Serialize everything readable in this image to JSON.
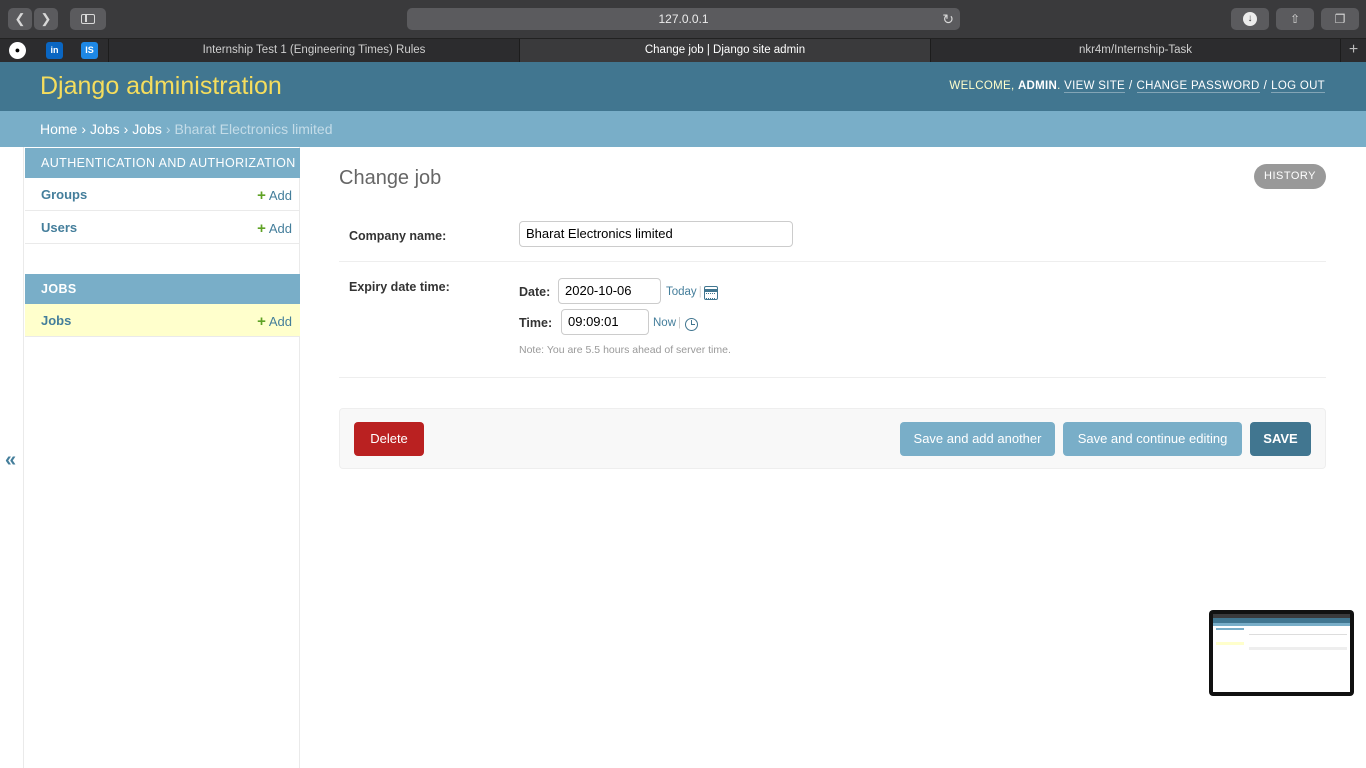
{
  "browser": {
    "url": "127.0.0.1",
    "tabs": [
      "Internship Test 1 (Engineering Times) Rules",
      "Change job | Django site admin",
      "nkr4m/Internship-Task"
    ],
    "favicons": {
      "github": "",
      "linkedin": "in",
      "is": "IS"
    }
  },
  "header": {
    "branding": "Django administration",
    "welcome": "WELCOME,",
    "username": "ADMIN",
    "view_site": "VIEW SITE",
    "change_password": "CHANGE PASSWORD",
    "log_out": "LOG OUT"
  },
  "breadcrumbs": {
    "home": "Home",
    "app": "Jobs",
    "model": "Jobs",
    "current": "Bharat Electronics limited"
  },
  "sidebar": {
    "collapse": "«",
    "modules": [
      {
        "caption": "AUTHENTICATION AND AUTHORIZATION",
        "models": [
          {
            "name": "Groups",
            "add": "Add"
          },
          {
            "name": "Users",
            "add": "Add"
          }
        ]
      },
      {
        "caption": "JOBS",
        "models": [
          {
            "name": "Jobs",
            "add": "Add"
          }
        ]
      }
    ]
  },
  "content": {
    "title": "Change job",
    "history": "HISTORY",
    "company_label": "Company name:",
    "company_value": "Bharat Electronics limited",
    "expiry_label": "Expiry date time:",
    "date_label": "Date:",
    "date_value": "2020-10-06",
    "today": "Today",
    "time_label": "Time:",
    "time_value": "09:09:01",
    "now": "Now",
    "note": "Note: You are 5.5 hours ahead of server time."
  },
  "actions": {
    "delete": "Delete",
    "save_add_another": "Save and add another",
    "save_continue": "Save and continue editing",
    "save": "SAVE"
  },
  "colors": {
    "header": "#417690",
    "branding": "#f5dd5d",
    "breadcrumbs": "#79aec8",
    "delete": "#ba2121",
    "link": "#447e9b",
    "add_plus": "#5fa225"
  }
}
